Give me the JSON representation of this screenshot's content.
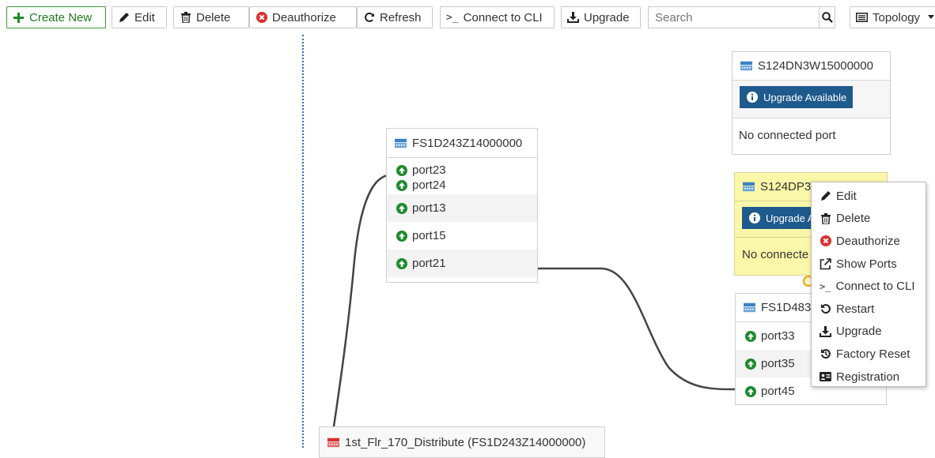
{
  "toolbar": {
    "create_new": "Create New",
    "edit": "Edit",
    "delete": "Delete",
    "deauthorize": "Deauthorize",
    "refresh": "Refresh",
    "connect_cli": "Connect to CLI",
    "upgrade": "Upgrade",
    "search_placeholder": "Search",
    "view_select": "Topology"
  },
  "switches": {
    "s124dn": {
      "name": "S124DN3W15000000",
      "badge": "Upgrade Available",
      "status": "No connected port"
    },
    "fs1d243": {
      "name": "FS1D243Z14000000",
      "ports": [
        "port23",
        "port24",
        "port13",
        "port15",
        "port21"
      ]
    },
    "s124dp": {
      "name": "S124DP3",
      "badge": "Upgrade A",
      "status": "No connecte"
    },
    "fs1d483": {
      "name": "FS1D483",
      "ports": [
        "port33",
        "port35",
        "port45"
      ]
    },
    "distribute": {
      "name": "1st_Flr_170_Distribute (FS1D243Z14000000)"
    }
  },
  "context_menu": {
    "items": [
      "Edit",
      "Delete",
      "Deauthorize",
      "Show Ports",
      "Connect to CLI",
      "Restart",
      "Upgrade",
      "Factory Reset",
      "Registration"
    ]
  },
  "colors": {
    "accent_blue": "#1e5a8c",
    "port_up_green": "#1e8a2e",
    "delete_red": "#d9302c",
    "highlight_yellow": "#fbf7a8",
    "link_line": "#444444"
  }
}
